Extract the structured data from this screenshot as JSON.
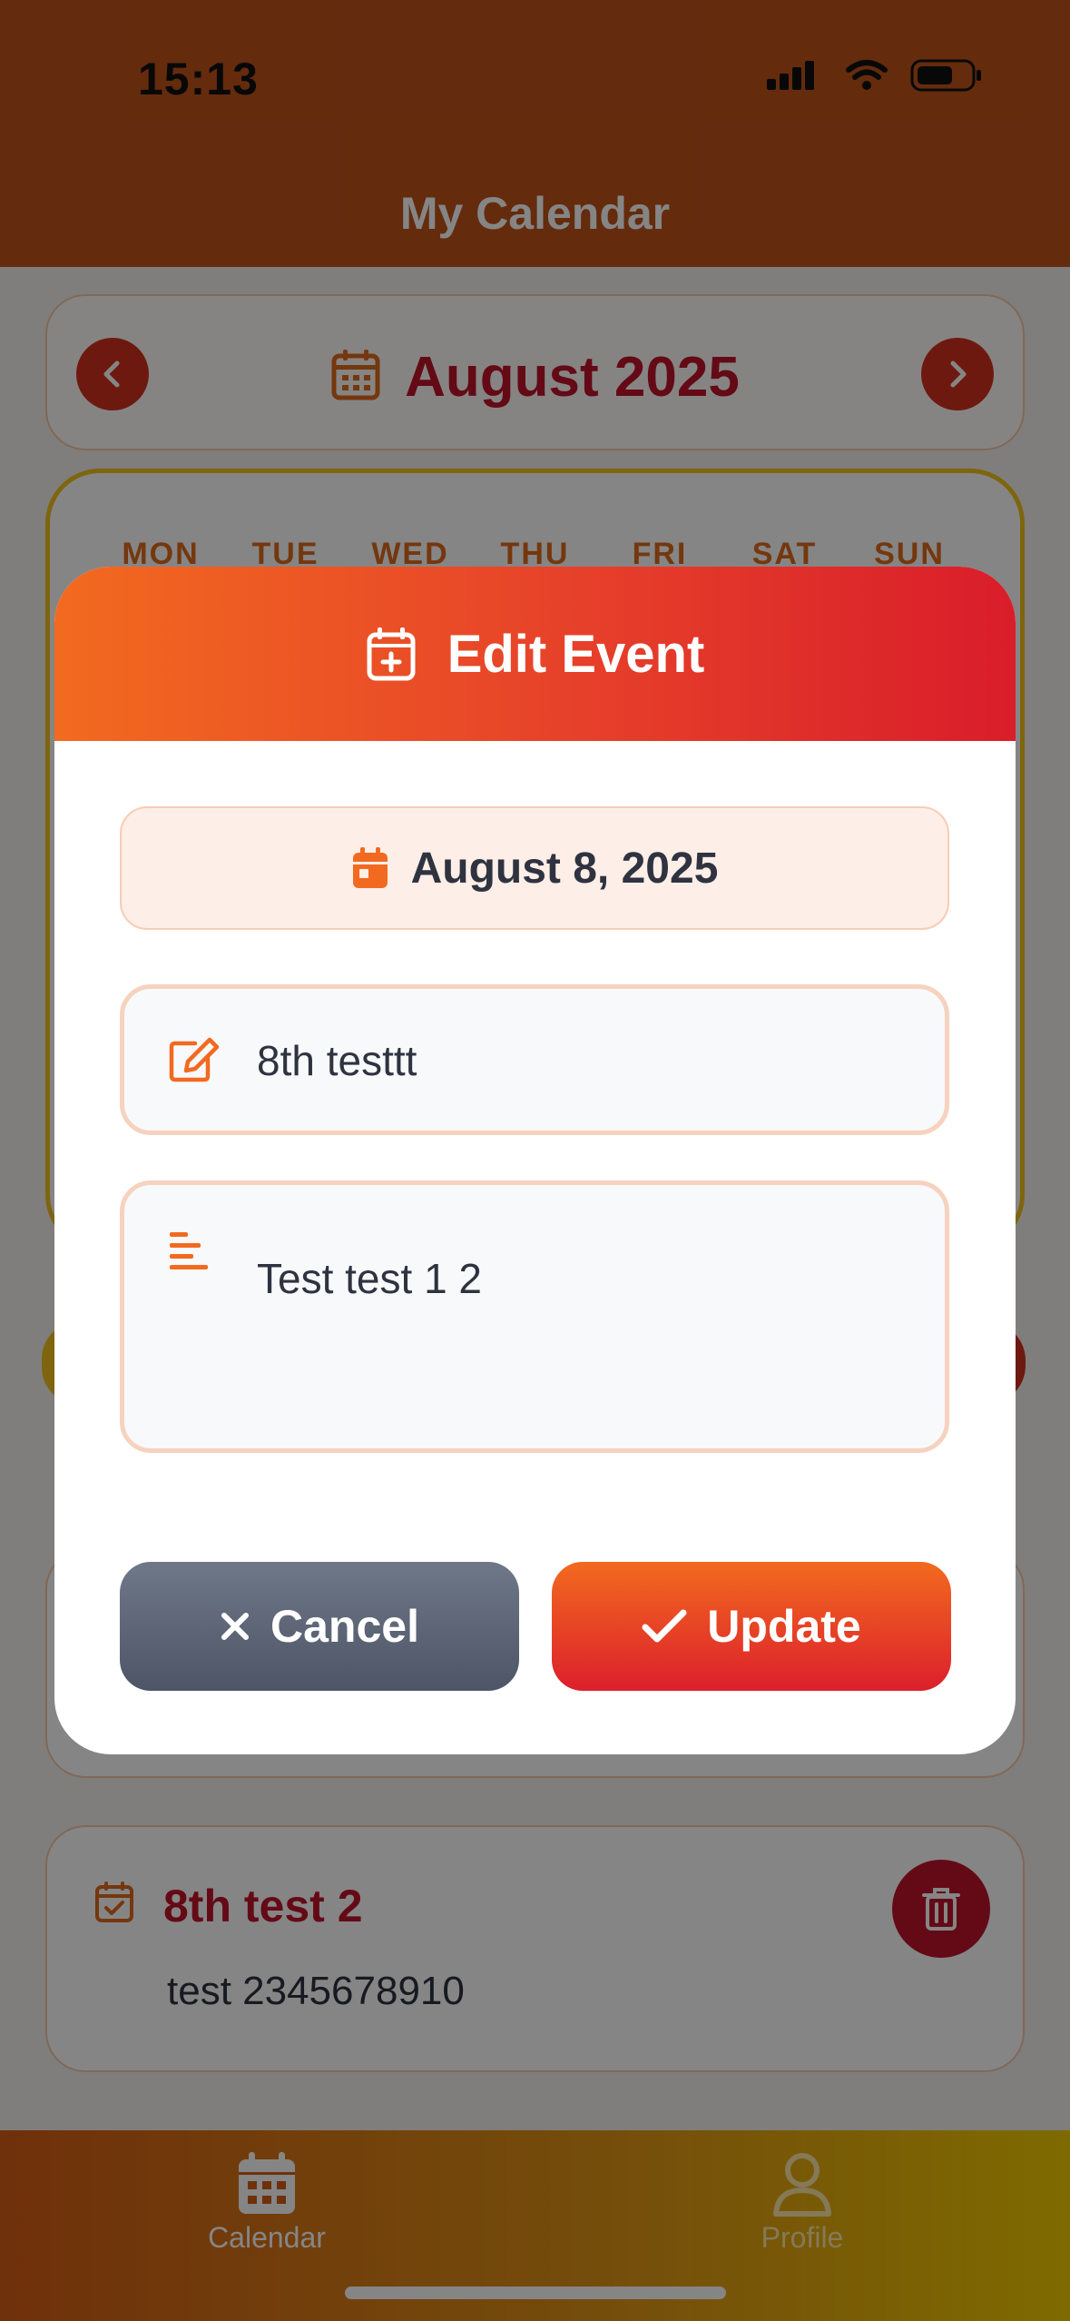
{
  "status_bar": {
    "time": "15:13",
    "icons": [
      "signal-icon",
      "wifi-icon",
      "battery-icon"
    ]
  },
  "header": {
    "title": "My Calendar"
  },
  "month_nav": {
    "label": "August 2025",
    "prev_icon": "chevron-left-icon",
    "next_icon": "chevron-right-icon"
  },
  "weekdays": [
    "MON",
    "TUE",
    "WED",
    "THU",
    "FRI",
    "SAT",
    "SUN"
  ],
  "events": [
    {
      "title": "8th test 2",
      "description": "test 2345678910",
      "icon": "calendar-check-icon",
      "delete_icon": "trash-icon"
    }
  ],
  "tabbar": {
    "items": [
      {
        "label": "Calendar",
        "icon": "calendar-grid-icon"
      },
      {
        "label": "Profile",
        "icon": "user-icon"
      }
    ]
  },
  "modal": {
    "title": "Edit Event",
    "title_icon": "calendar-plus-icon",
    "date": "August 8, 2025",
    "title_field": {
      "value": "8th testtt",
      "icon": "edit-icon"
    },
    "description_field": {
      "value": "Test test 1 2",
      "icon": "align-left-icon"
    },
    "cancel_label": "Cancel",
    "update_label": "Update"
  },
  "colors": {
    "accent_orange": "#f26a1f",
    "accent_red": "#dc1f2c",
    "brand_dark_red": "#c0152b",
    "yellow": "#f1c21b"
  }
}
